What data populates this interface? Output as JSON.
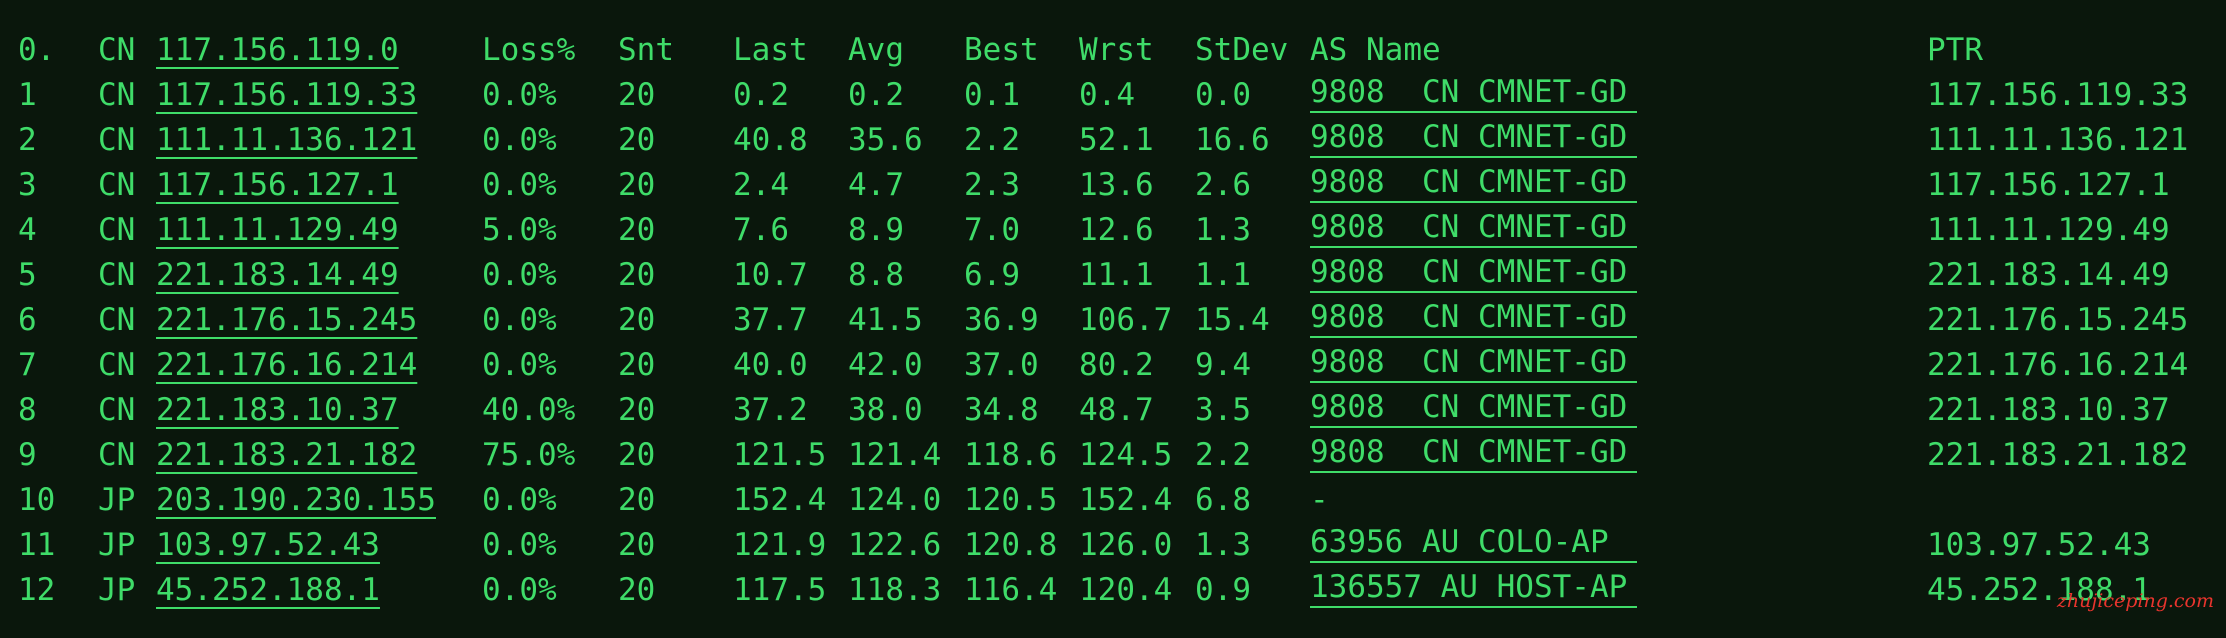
{
  "colors": {
    "background": "#0a170c",
    "text": "#3fdc69",
    "watermark": "#e8342d"
  },
  "header": {
    "hop": "0.",
    "cc": "CN",
    "ip": "117.156.119.0",
    "loss": "Loss%",
    "snt": "Snt",
    "last": "Last",
    "avg": "Avg",
    "best": "Best",
    "wrst": "Wrst",
    "stdev": "StDev",
    "as_name": "AS Name",
    "ptr": "PTR"
  },
  "rows": [
    {
      "hop": "1",
      "cc": "CN",
      "ip": "117.156.119.33",
      "loss": "0.0%",
      "snt": "20",
      "last": "0.2",
      "avg": "0.2",
      "best": "0.1",
      "wrst": "0.4",
      "stdev": "0.0",
      "as_name": "9808  CN CMNET-GD",
      "ptr": "117.156.119.33"
    },
    {
      "hop": "2",
      "cc": "CN",
      "ip": "111.11.136.121",
      "loss": "0.0%",
      "snt": "20",
      "last": "40.8",
      "avg": "35.6",
      "best": "2.2",
      "wrst": "52.1",
      "stdev": "16.6",
      "as_name": "9808  CN CMNET-GD",
      "ptr": "111.11.136.121"
    },
    {
      "hop": "3",
      "cc": "CN",
      "ip": "117.156.127.1",
      "loss": "0.0%",
      "snt": "20",
      "last": "2.4",
      "avg": "4.7",
      "best": "2.3",
      "wrst": "13.6",
      "stdev": "2.6",
      "as_name": "9808  CN CMNET-GD",
      "ptr": "117.156.127.1"
    },
    {
      "hop": "4",
      "cc": "CN",
      "ip": "111.11.129.49",
      "loss": "5.0%",
      "snt": "20",
      "last": "7.6",
      "avg": "8.9",
      "best": "7.0",
      "wrst": "12.6",
      "stdev": "1.3",
      "as_name": "9808  CN CMNET-GD",
      "ptr": "111.11.129.49"
    },
    {
      "hop": "5",
      "cc": "CN",
      "ip": "221.183.14.49",
      "loss": "0.0%",
      "snt": "20",
      "last": "10.7",
      "avg": "8.8",
      "best": "6.9",
      "wrst": "11.1",
      "stdev": "1.1",
      "as_name": "9808  CN CMNET-GD",
      "ptr": "221.183.14.49"
    },
    {
      "hop": "6",
      "cc": "CN",
      "ip": "221.176.15.245",
      "loss": "0.0%",
      "snt": "20",
      "last": "37.7",
      "avg": "41.5",
      "best": "36.9",
      "wrst": "106.7",
      "stdev": "15.4",
      "as_name": "9808  CN CMNET-GD",
      "ptr": "221.176.15.245"
    },
    {
      "hop": "7",
      "cc": "CN",
      "ip": "221.176.16.214",
      "loss": "0.0%",
      "snt": "20",
      "last": "40.0",
      "avg": "42.0",
      "best": "37.0",
      "wrst": "80.2",
      "stdev": "9.4",
      "as_name": "9808  CN CMNET-GD",
      "ptr": "221.176.16.214"
    },
    {
      "hop": "8",
      "cc": "CN",
      "ip": "221.183.10.37",
      "loss": "40.0%",
      "snt": "20",
      "last": "37.2",
      "avg": "38.0",
      "best": "34.8",
      "wrst": "48.7",
      "stdev": "3.5",
      "as_name": "9808  CN CMNET-GD",
      "ptr": "221.183.10.37"
    },
    {
      "hop": "9",
      "cc": "CN",
      "ip": "221.183.21.182",
      "loss": "75.0%",
      "snt": "20",
      "last": "121.5",
      "avg": "121.4",
      "best": "118.6",
      "wrst": "124.5",
      "stdev": "2.2",
      "as_name": "9808  CN CMNET-GD",
      "ptr": "221.183.21.182"
    },
    {
      "hop": "10",
      "cc": "JP",
      "ip": "203.190.230.155",
      "loss": "0.0%",
      "snt": "20",
      "last": "152.4",
      "avg": "124.0",
      "best": "120.5",
      "wrst": "152.4",
      "stdev": "6.8",
      "as_name": "-",
      "ptr": ""
    },
    {
      "hop": "11",
      "cc": "JP",
      "ip": "103.97.52.43",
      "loss": "0.0%",
      "snt": "20",
      "last": "121.9",
      "avg": "122.6",
      "best": "120.8",
      "wrst": "126.0",
      "stdev": "1.3",
      "as_name": "63956 AU COLO-AP",
      "ptr": "103.97.52.43"
    },
    {
      "hop": "12",
      "cc": "JP",
      "ip": "45.252.188.1",
      "loss": "0.0%",
      "snt": "20",
      "last": "117.5",
      "avg": "118.3",
      "best": "116.4",
      "wrst": "120.4",
      "stdev": "0.9",
      "as_name": "136557 AU HOST-AP",
      "ptr": "45.252.188.1"
    }
  ],
  "watermark": "zhujiceping.com"
}
